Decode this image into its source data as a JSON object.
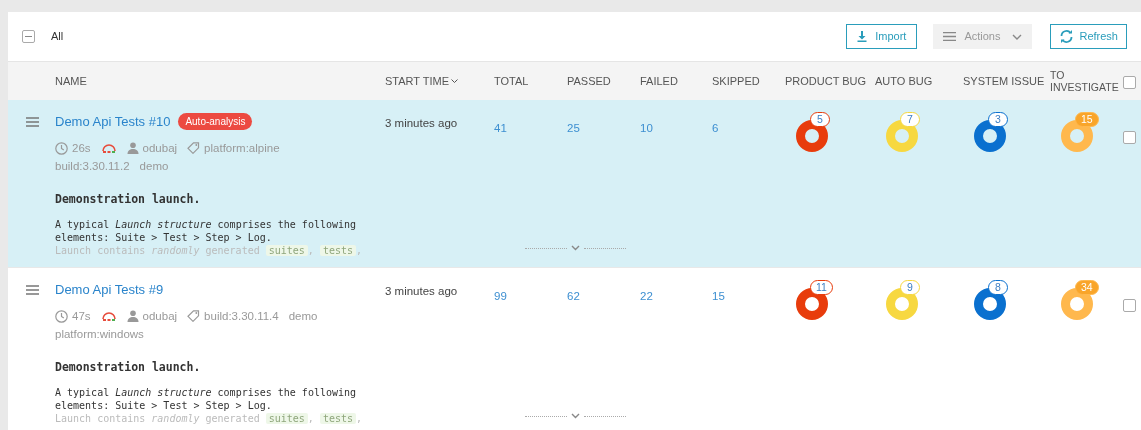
{
  "toolbar": {
    "select_all": {
      "label": "All",
      "indeterminate": true
    },
    "buttons": [
      {
        "kind": "import",
        "label": "Import"
      },
      {
        "kind": "actions",
        "label": "Actions"
      },
      {
        "kind": "refresh",
        "label": "Refresh"
      }
    ]
  },
  "columns": [
    {
      "label": "NAME",
      "sorted": false
    },
    {
      "label": "START TIME",
      "sorted": true
    },
    {
      "label": "TOTAL",
      "sorted": false
    },
    {
      "label": "PASSED",
      "sorted": false
    },
    {
      "label": "FAILED",
      "sorted": false
    },
    {
      "label": "SKIPPED",
      "sorted": false
    },
    {
      "label": "PRODUCT BUG",
      "sorted": false
    },
    {
      "label": "AUTO BUG",
      "sorted": false
    },
    {
      "label": "SYSTEM ISSUE",
      "sorted": false
    },
    {
      "label": "TO INVESTIGATE",
      "sorted": false
    }
  ],
  "header_checkbox": {
    "checked": false
  },
  "launches": [
    {
      "name": "Demo Api Tests #10",
      "selected": true,
      "badge": "Auto-analysis",
      "duration": "26s",
      "owner": "odubaj",
      "attributes": [
        "platform:alpine",
        "build:3.30.11.2",
        "demo"
      ],
      "start_time": "3 minutes ago",
      "total": "41",
      "passed": "25",
      "failed": "10",
      "skipped": "6",
      "defects": [
        {
          "kind": "product_bug",
          "count": "5",
          "color": "#e83c0c"
        },
        {
          "kind": "auto_bug",
          "count": "7",
          "color": "#f7d840"
        },
        {
          "kind": "system_issue",
          "count": "3",
          "color": "#0a70cf"
        },
        {
          "kind": "to_investigate",
          "count": "15",
          "color": "#ffb84d"
        }
      ],
      "checked": false,
      "description": {
        "title": "Demonstration launch.",
        "text": "A typical *Launch structure* comprises the following elements: Suite > Test > Step > Log.",
        "fade_text": "Launch contains *randomly* generated",
        "fade_tags": [
          "suites",
          "tests"
        ],
        "separator": ","
      }
    },
    {
      "name": "Demo Api Tests #9",
      "selected": false,
      "duration": "47s",
      "owner": "odubaj",
      "attributes": [
        "build:3.30.11.4",
        "demo",
        "platform:windows"
      ],
      "start_time": "3 minutes ago",
      "total": "99",
      "passed": "62",
      "failed": "22",
      "skipped": "15",
      "defects": [
        {
          "kind": "product_bug",
          "count": "11",
          "color": "#e83c0c"
        },
        {
          "kind": "auto_bug",
          "count": "9",
          "color": "#f7d840"
        },
        {
          "kind": "system_issue",
          "count": "8",
          "color": "#0a70cf"
        },
        {
          "kind": "to_investigate",
          "count": "34",
          "color": "#ffb84d"
        }
      ],
      "checked": false,
      "description": {
        "title": "Demonstration launch.",
        "text": "A typical *Launch structure* comprises the following elements: Suite > Test > Step > Log.",
        "fade_text": "Launch contains *randomly* generated",
        "fade_tags": [
          "suites",
          "tests"
        ],
        "separator": ","
      }
    }
  ]
}
